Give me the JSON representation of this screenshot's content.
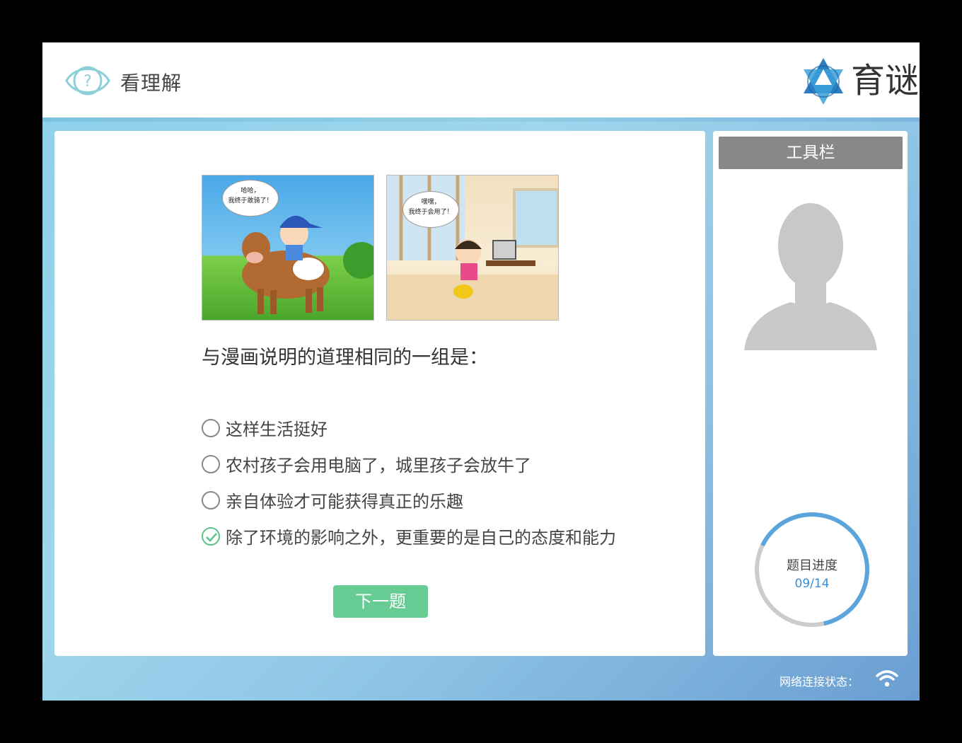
{
  "header": {
    "title": "看理解",
    "logo_text": "育谜"
  },
  "comic": {
    "panel1_bubble_line1": "哈哈，",
    "panel1_bubble_line2": "我终于敢骑了！",
    "panel2_bubble_line1": "嘿嘿，",
    "panel2_bubble_line2": "我终于会用了！"
  },
  "question": {
    "text": "与漫画说明的道理相同的一组是：",
    "options": [
      {
        "label": "这样生活挺好",
        "selected": false
      },
      {
        "label": "农村孩子会用电脑了，城里孩子会放牛了",
        "selected": false
      },
      {
        "label": "亲自体验才可能获得真正的乐趣",
        "selected": false
      },
      {
        "label": "除了环境的影响之外，更重要的是自己的态度和能力",
        "selected": true
      }
    ],
    "next_label": "下一题"
  },
  "sidebar": {
    "toolbar_title": "工具栏",
    "progress_label": "题目进度",
    "progress_value": "09/14",
    "progress_fraction": 0.6429
  },
  "footer": {
    "network_label": "网络连接状态："
  },
  "colors": {
    "accent_green": "#66cc94",
    "progress_blue": "#5aa6dc",
    "toolbar_gray": "#888888"
  }
}
